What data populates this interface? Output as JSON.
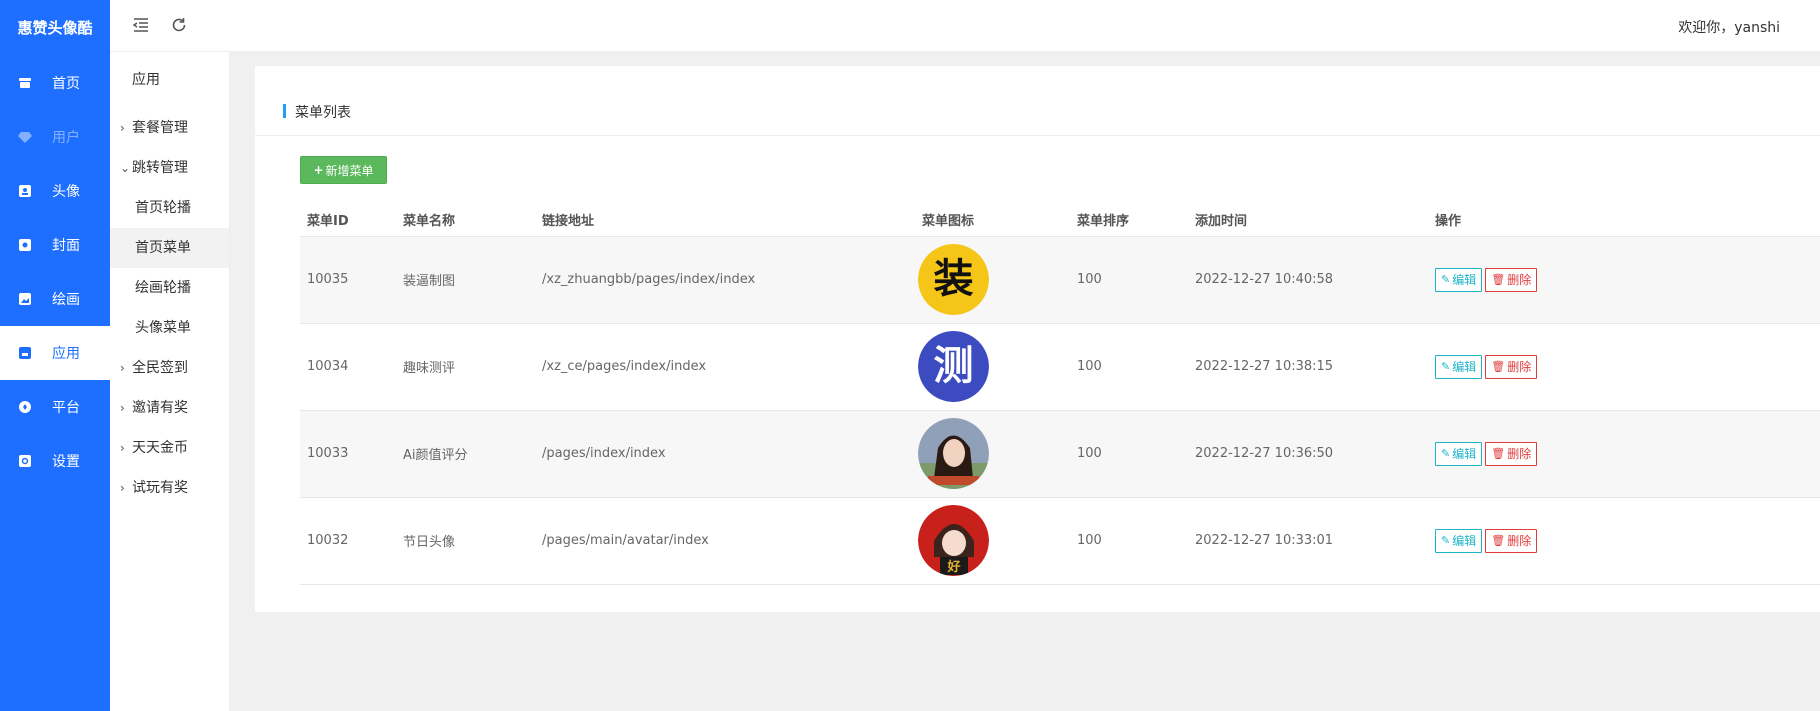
{
  "brand": "惠赞头像酷",
  "colors": {
    "primary": "#1e6fff",
    "accent_bar": "#1e9fff",
    "add_button": "#5cb85c",
    "edit": "#1fb5c8",
    "delete": "#e03c3c"
  },
  "nav": [
    {
      "label": "首页",
      "icon": "store-icon"
    },
    {
      "label": "用户",
      "icon": "diamond-icon"
    },
    {
      "label": "头像",
      "icon": "portrait-icon"
    },
    {
      "label": "封面",
      "icon": "camera-icon"
    },
    {
      "label": "绘画",
      "icon": "picture-icon"
    },
    {
      "label": "应用",
      "icon": "app-icon"
    },
    {
      "label": "平台",
      "icon": "compass-icon"
    },
    {
      "label": "设置",
      "icon": "settings-icon"
    }
  ],
  "subnav": {
    "title": "应用",
    "groups": [
      {
        "label": "套餐管理",
        "expanded": false
      },
      {
        "label": "跳转管理",
        "expanded": true,
        "items": [
          "首页轮播",
          "首页菜单",
          "绘画轮播",
          "头像菜单"
        ]
      },
      {
        "label": "全民签到",
        "expanded": false
      },
      {
        "label": "邀请有奖",
        "expanded": false
      },
      {
        "label": "天天金币",
        "expanded": false
      },
      {
        "label": "试玩有奖",
        "expanded": false
      }
    ]
  },
  "header": {
    "welcome": "欢迎你，yanshi",
    "collapse_icon": "menu-fold-icon",
    "refresh_icon": "refresh-icon"
  },
  "panel": {
    "title": "菜单列表",
    "add_button": "新增菜单",
    "columns": [
      "菜单ID",
      "菜单名称",
      "链接地址",
      "菜单图标",
      "菜单排序",
      "添加时间",
      "操作"
    ],
    "rows": [
      {
        "id": "10035",
        "name": "装逼制图",
        "link": "/xz_zhuangbb/pages/index/index",
        "icon_char": "装",
        "sort": "100",
        "time": "2022-12-27 10:40:58"
      },
      {
        "id": "10034",
        "name": "趣味测评",
        "link": "/xz_ce/pages/index/index",
        "icon_char": "测",
        "sort": "100",
        "time": "2022-12-27 10:38:15"
      },
      {
        "id": "10033",
        "name": "Ai颜值评分",
        "link": "/pages/index/index",
        "icon_char": "",
        "sort": "100",
        "time": "2022-12-27 10:36:50"
      },
      {
        "id": "10032",
        "name": "节日头像",
        "link": "/pages/main/avatar/index",
        "icon_char": "好",
        "sort": "100",
        "time": "2022-12-27 10:33:01"
      }
    ],
    "actions": {
      "edit": "编辑",
      "delete": "删除"
    }
  }
}
